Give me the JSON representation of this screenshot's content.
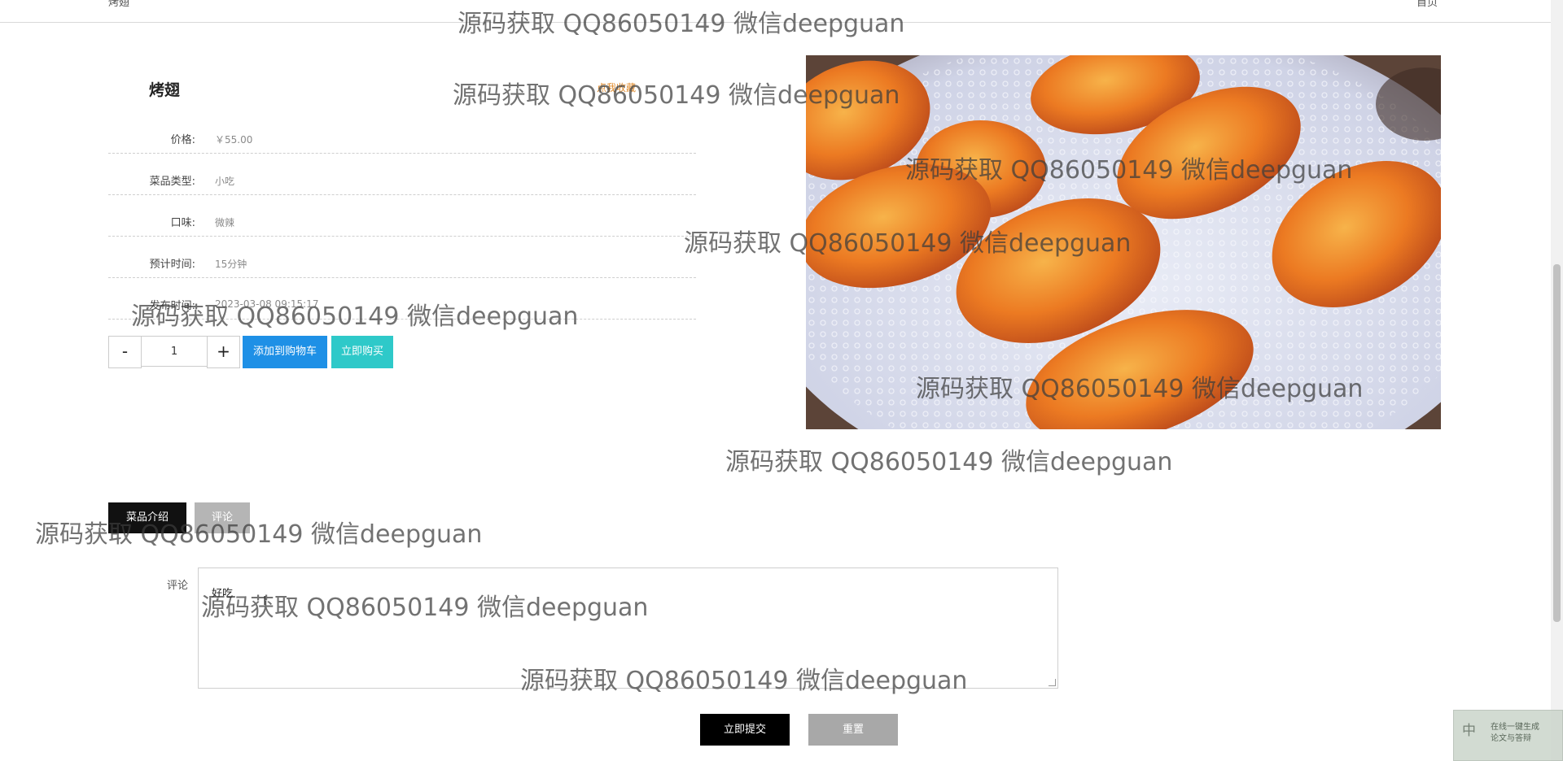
{
  "topbar": {
    "breadcrumb": "烤翅",
    "back_label": "首页"
  },
  "product": {
    "name": "烤翅",
    "favorite": "点我收藏",
    "details": [
      {
        "label": "价格:",
        "value": "￥55.00"
      },
      {
        "label": "菜品类型:",
        "value": "小吃"
      },
      {
        "label": "口味:",
        "value": "微辣"
      },
      {
        "label": "预计时间:",
        "value": "15分钟"
      },
      {
        "label": "发布时间:",
        "value": "2023-03-08 09:15:17"
      }
    ],
    "image_alt": "烤翅"
  },
  "quantity": {
    "minus": "-",
    "value": "1",
    "plus": "+"
  },
  "actions": {
    "add_to_cart": "添加到购物车",
    "buy_now": "立即购买"
  },
  "tabs": {
    "intro": "菜品介绍",
    "comment": "评论"
  },
  "comment_form": {
    "label": "评论",
    "value": "好吃",
    "submit": "立即提交",
    "reset": "重置"
  },
  "ime": {
    "lang": "中",
    "line1": "在线一键生成",
    "line2": "论文与答辩"
  },
  "watermark": "源码获取 QQ86050149 微信deepguan"
}
